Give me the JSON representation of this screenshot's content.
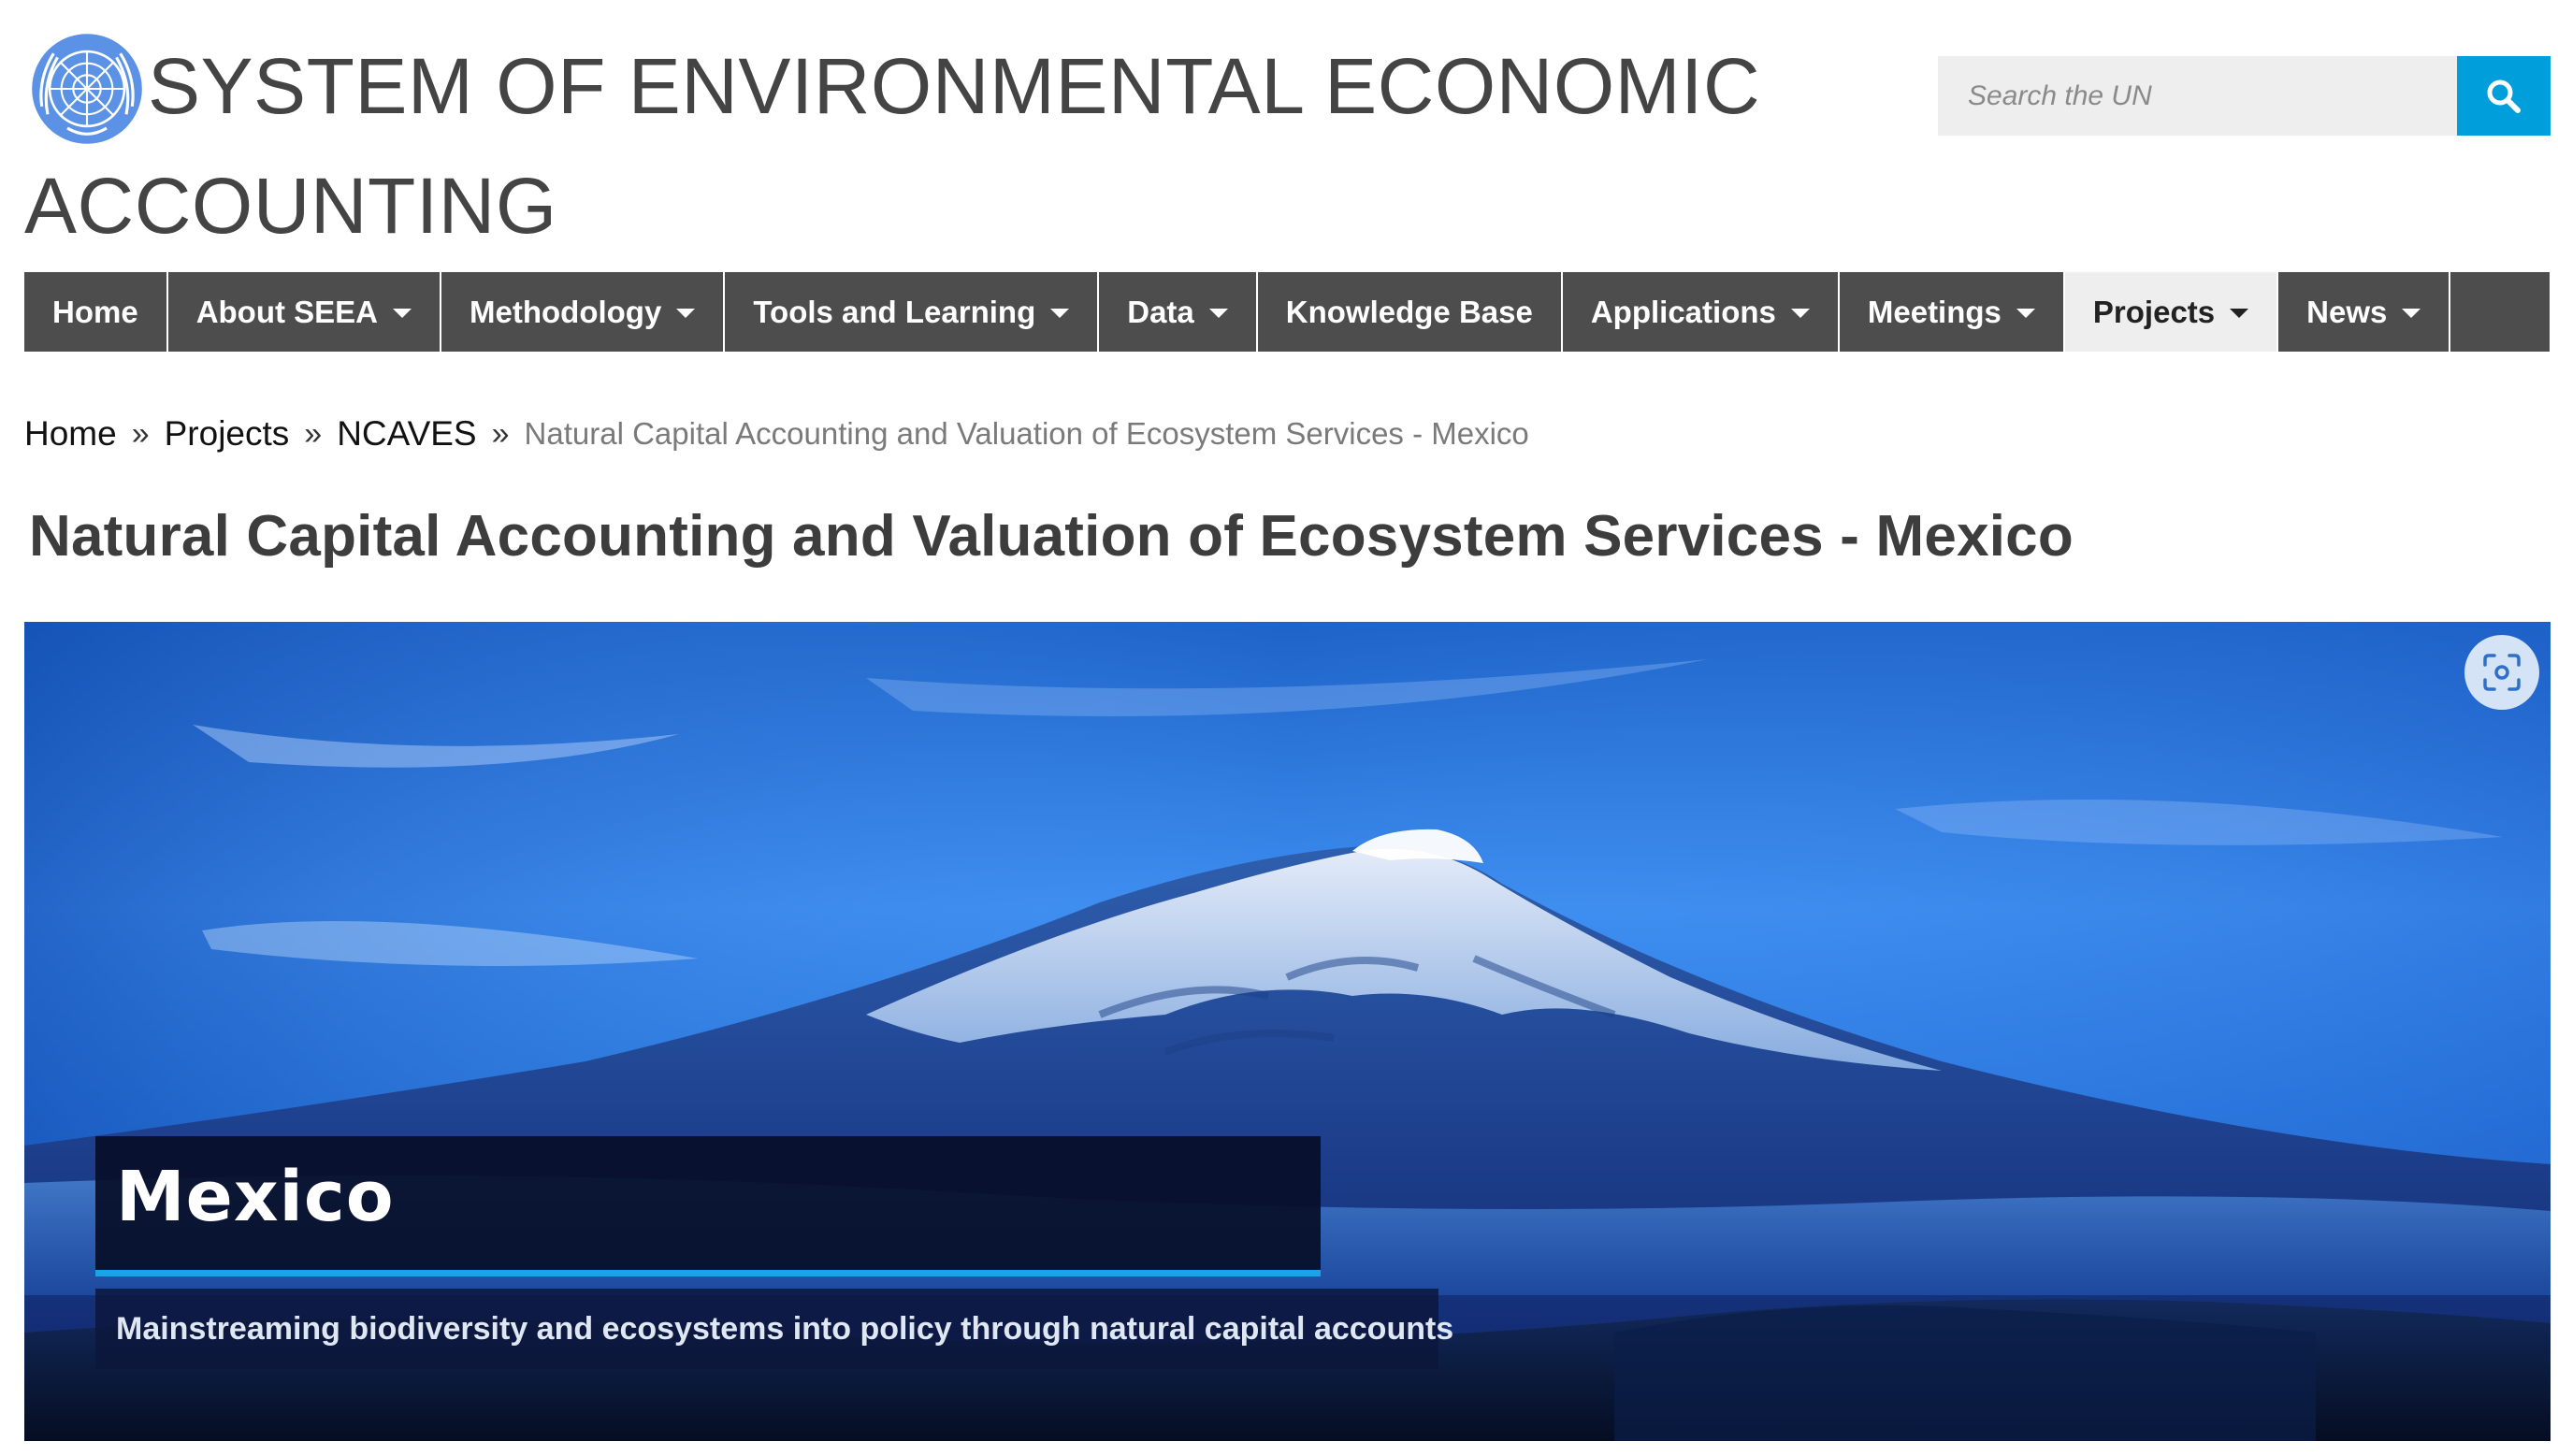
{
  "header": {
    "site_title": "SYSTEM OF ENVIRONMENTAL ECONOMIC ACCOUNTING",
    "logo_icon": "un-emblem-icon",
    "search": {
      "placeholder": "Search the UN",
      "value": "",
      "button_icon": "search-icon"
    }
  },
  "nav": {
    "items": [
      {
        "label": "Home",
        "dropdown": false
      },
      {
        "label": "About SEEA",
        "dropdown": true
      },
      {
        "label": "Methodology",
        "dropdown": true
      },
      {
        "label": "Tools and Learning",
        "dropdown": true
      },
      {
        "label": "Data",
        "dropdown": true
      },
      {
        "label": "Knowledge Base",
        "dropdown": false
      },
      {
        "label": "Applications",
        "dropdown": true
      },
      {
        "label": "Meetings",
        "dropdown": true
      },
      {
        "label": "Projects",
        "dropdown": true,
        "active": true
      },
      {
        "label": "News",
        "dropdown": true
      }
    ]
  },
  "breadcrumb": {
    "items": [
      "Home",
      "Projects",
      "NCAVES"
    ],
    "separator": "»",
    "current": "Natural Capital Accounting and Valuation of Ecosystem Services - Mexico"
  },
  "page": {
    "title": "Natural Capital Accounting and Valuation of Ecosystem Services - Mexico"
  },
  "hero": {
    "title": "Mexico",
    "subtitle": "Mainstreaming biodiversity and ecosystems into policy through natural capital accounts",
    "capture_icon": "visual-search-icon"
  },
  "colors": {
    "accent": "#009edb",
    "nav_background": "#4d4d4d",
    "nav_active_background": "#eeeeee",
    "hero_underline": "#1aa3e8"
  }
}
